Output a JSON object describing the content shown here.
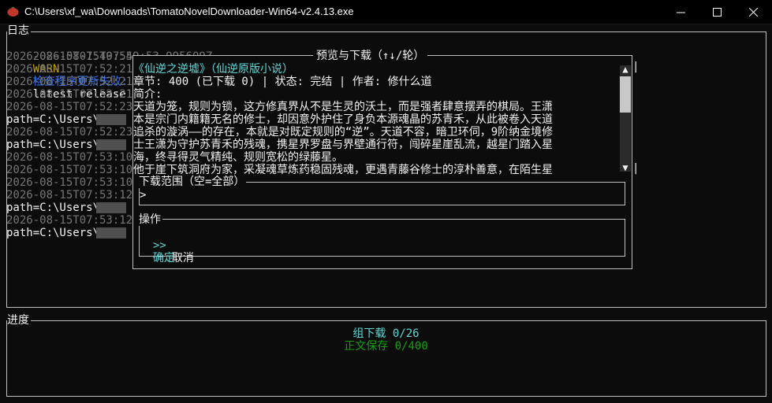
{
  "window": {
    "title": "C:\\Users\\xf_wa\\Downloads\\TomatoNovelDownloader-Win64-v2.4.13.exe",
    "min_glyph": "—",
    "max_glyph": "☐",
    "close_glyph": "✕"
  },
  "log_panel": {
    "title": "日志",
    "entries": [
      {
        "time": "2026-08-15T07:49:53.995609Z",
        "level": "WARN",
        "msg": "检查程序更新失败:",
        "detail": "latest release status"
      },
      {
        "time": "2026-08-15T07:49:55"
      },
      {
        "time": "2026-08-15T07:52:21"
      },
      {
        "time": "2026-08-15T07:52:21"
      },
      {
        "time": "2026-08-15T07:52:21"
      },
      {
        "time": "2026-08-15T07:52:23"
      },
      {
        "text": "path=C:\\Users\\"
      },
      {
        "time": "2026-08-15T07:52:23"
      },
      {
        "text": "path=C:\\Users\\"
      },
      {
        "time": "2026-08-15T07:53:10"
      },
      {
        "time": "2026-08-15T07:53:10"
      },
      {
        "time": "2026-08-15T07:53:10"
      },
      {
        "time": "2026-08-15T07:53:12"
      },
      {
        "text": "path=C:\\Users\\"
      },
      {
        "time": "2026-08-15T07:53:12"
      },
      {
        "text": "path=C:\\Users\\"
      }
    ]
  },
  "preview": {
    "title": "预览与下载（↑↓/轮）",
    "book_title": "《仙逆之逆墟》（仙逆原版小说）",
    "meta": "章节: 400 (已下载 0) | 状态: 完结 | 作者: 修什么道",
    "intro_label": "简介:",
    "intro_lines": [
      "天道为笼，规则为锁，这方修真界从不是生灵的沃土，而是强者肆意摆弄的棋局。王潇",
      "本是宗门内籍籍无名的修士，却因意外护住了身负本源魂晶的苏青禾，从此被卷入天道",
      "追杀的漩涡——的存在，本就是对既定规则的“逆”。天道不容，暗卫环伺，9阶纳金境修",
      "士王潇为守护苏青禾的残魂，携星界罗盘与界壁通行符，闯碎星崖乱流，越星门踏入星",
      "海，终寻得灵气精纯、规则宽松的绿藤星。",
      "他于崖下筑洞府为家，采凝魂草炼药稳固残魂，更遇青藤谷修士的淳朴善意，在陌生星"
    ],
    "scroll_up": "▲",
    "scroll_down": "▼",
    "range": {
      "label": "下载范围（空=全部）",
      "prompt": ">",
      "value": ""
    },
    "actions": {
      "label": "操作",
      "cursor": ">>",
      "confirm": "确定",
      "cancel": "取消"
    }
  },
  "progress_panel": {
    "title": "进度",
    "group_download": "组下载 0/26",
    "text_save": "正文保存 0/400"
  },
  "colors": {
    "background": "#0c0c0c",
    "dim_text": "#767676",
    "warn": "#c19c00",
    "info_blue": "#3b78ff",
    "cyan": "#61d6d6",
    "green": "#13a10e"
  }
}
